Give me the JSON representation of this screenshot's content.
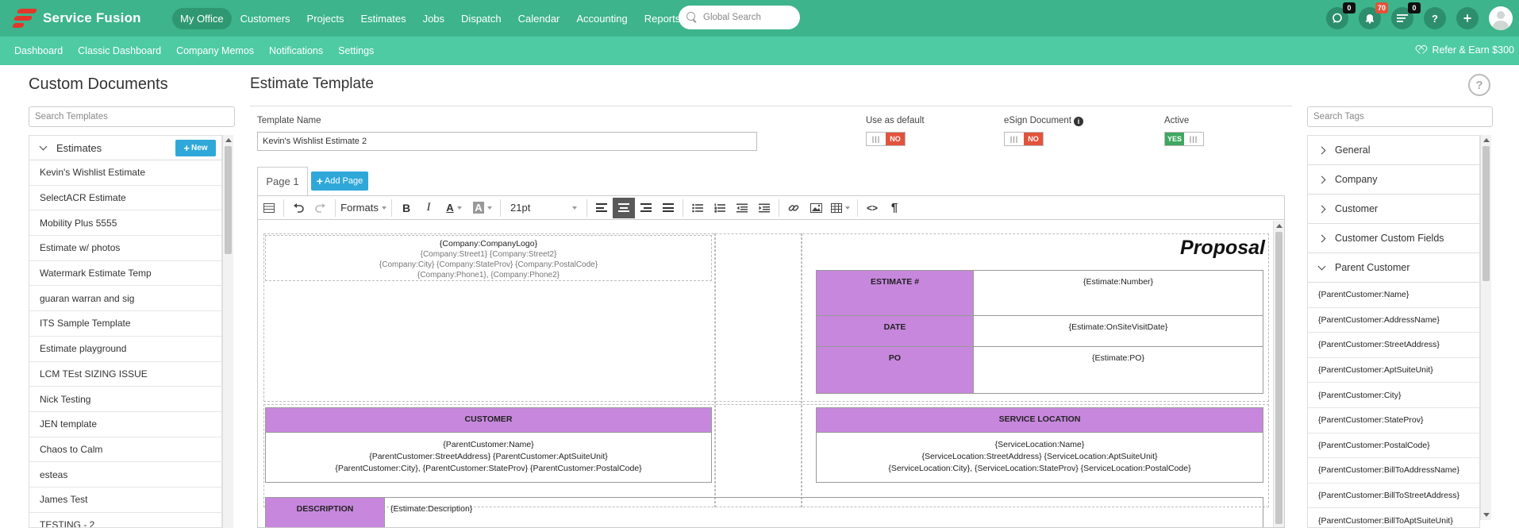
{
  "app": {
    "brand": "Service Fusion",
    "accent": "#3db48b",
    "accent_light": "#4ecba3",
    "logo_color": "#e2372c"
  },
  "nav": {
    "items": [
      "My Office",
      "Customers",
      "Projects",
      "Estimates",
      "Jobs",
      "Dispatch",
      "Calendar",
      "Accounting",
      "Reports"
    ],
    "active": "My Office",
    "search_placeholder": "Global Search",
    "badges": {
      "chat": "0",
      "notifications": "70",
      "tasks": "0"
    },
    "help_glyph": "?",
    "add_glyph": "+"
  },
  "subnav": {
    "items": [
      "Dashboard",
      "Classic Dashboard",
      "Company Memos",
      "Notifications",
      "Settings"
    ],
    "refer": "Refer & Earn $300"
  },
  "left": {
    "title": "Custom Documents",
    "search_placeholder": "Search Templates",
    "group": "Estimates",
    "new_label": "New",
    "templates": [
      "Kevin's Wishlist Estimate",
      "SelectACR Estimate",
      "Mobility Plus 5555",
      "Estimate w/ photos",
      "Watermark Estimate Temp",
      "guaran warran and sig",
      "ITS Sample Template",
      "Estimate playground",
      "LCM TEst SIZING ISSUE",
      "Nick Testing",
      "JEN template",
      "Chaos to Calm",
      "esteas",
      "James Test",
      "TESTING - 2"
    ]
  },
  "main": {
    "title": "Estimate Template",
    "help_glyph": "?",
    "template_name_label": "Template Name",
    "template_name_value": "Kevin's Wishlist Estimate 2",
    "use_default_label": "Use as default",
    "use_default_state": "NO",
    "esign_label": "eSign Document",
    "esign_state": "NO",
    "active_label": "Active",
    "active_state": "YES",
    "tab": "Page 1",
    "add_page": "Add Page"
  },
  "toolbar": {
    "formats": "Formats",
    "font_size": "21pt",
    "bold": "B",
    "italic": "I",
    "text_color": "A",
    "bg_color": "A",
    "code": "<>",
    "pilcrow": "¶"
  },
  "doc": {
    "company_logo": "{Company:CompanyLogo}",
    "company_street": "{Company:Street1} {Company:Street2}",
    "company_city": "{Company:City} {Company:StateProv} {Company:PostalCode}",
    "company_phone": "{Company:Phone1}, {Company:Phone2}",
    "proposal": "Proposal",
    "estimate_label": "ESTIMATE #",
    "estimate_value": "{Estimate:Number}",
    "date_label": "DATE",
    "date_value": "{Estimate:OnSiteVisitDate}",
    "po_label": "PO",
    "po_value": "{Estimate:PO}",
    "customer_head": "CUSTOMER",
    "customer_line1": "{ParentCustomer:Name}",
    "customer_line2": "{ParentCustomer:StreetAddress} {ParentCustomer:AptSuiteUnit}",
    "customer_line3": "{ParentCustomer:City}, {ParentCustomer:StateProv} {ParentCustomer:PostalCode}",
    "service_head": "SERVICE LOCATION",
    "service_line1": "{ServiceLocation:Name}",
    "service_line2": "{ServiceLocation:StreetAddress} {ServiceLocation:AptSuiteUnit}",
    "service_line3": "{ServiceLocation:City}, {ServiceLocation:StateProv} {ServiceLocation:PostalCode}",
    "description_label": "DESCRIPTION",
    "description_value": "{Estimate:Description}",
    "highlight_color": "#c787dd"
  },
  "right": {
    "search_placeholder": "Search Tags",
    "groups": [
      "General",
      "Company",
      "Customer",
      "Customer Custom Fields",
      "Parent Customer"
    ],
    "expanded": "Parent Customer",
    "tags": [
      "{ParentCustomer:Name}",
      "{ParentCustomer:AddressName}",
      "{ParentCustomer:StreetAddress}",
      "{ParentCustomer:AptSuiteUnit}",
      "{ParentCustomer:City}",
      "{ParentCustomer:StateProv}",
      "{ParentCustomer:PostalCode}",
      "{ParentCustomer:BillToAddressName}",
      "{ParentCustomer:BillToStreetAddress}",
      "{ParentCustomer:BillToAptSuiteUnit}"
    ]
  }
}
